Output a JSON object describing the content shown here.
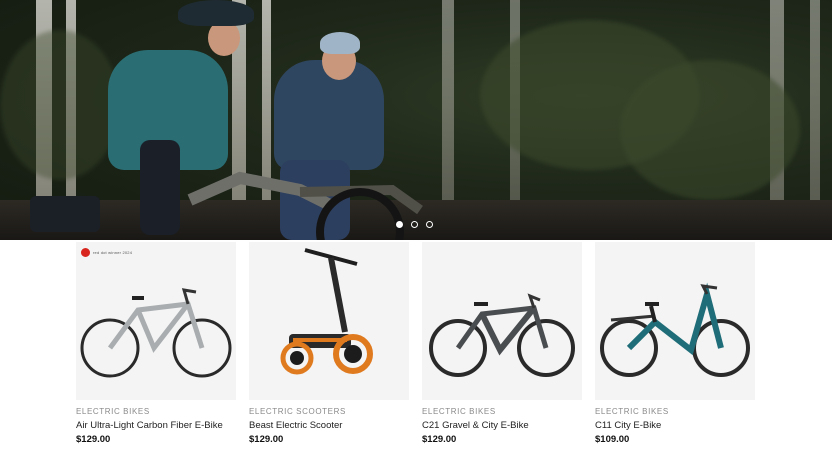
{
  "hero": {
    "slides": [
      {
        "label": "slide 1",
        "active": true
      },
      {
        "label": "slide 2",
        "active": false
      },
      {
        "label": "slide 3",
        "active": false
      }
    ]
  },
  "award_badge": "red dot winner 2024",
  "products": [
    {
      "category": "ELECTRIC BIKES",
      "name": "Air Ultra-Light Carbon Fiber E-Bike",
      "price": "$129.00",
      "frame_color": "#a9adb0",
      "image": "silver-road-ebike"
    },
    {
      "category": "ELECTRIC SCOOTERS",
      "name": "Beast Electric Scooter",
      "price": "$129.00",
      "frame_color": "#2a2a2a",
      "accent_color": "#e07a1f",
      "image": "orange-black-scooter"
    },
    {
      "category": "ELECTRIC BIKES",
      "name": "C21 Gravel & City E-Bike",
      "price": "$129.00",
      "frame_color": "#4a4d50",
      "image": "gray-gravel-ebike"
    },
    {
      "category": "ELECTRIC BIKES",
      "name": "C11 City E-Bike",
      "price": "$109.00",
      "frame_color": "#1f6d78",
      "image": "teal-city-ebike"
    }
  ]
}
